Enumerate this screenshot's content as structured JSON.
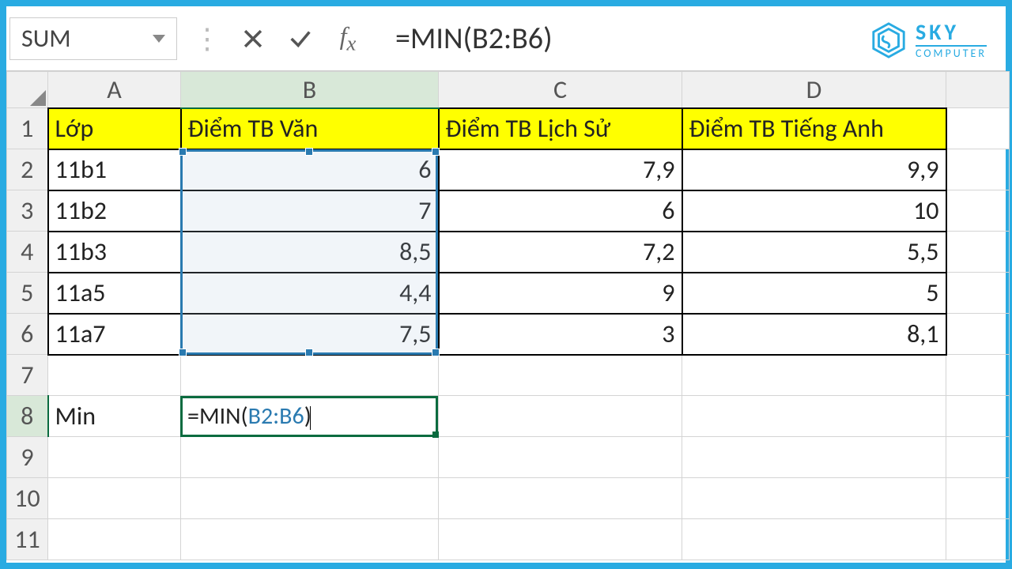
{
  "formula_bar": {
    "name_box": "SUM",
    "formula": "=MIN(B2:B6)"
  },
  "logo": {
    "top": "SKY",
    "bot": "COMPUTER"
  },
  "columns": [
    "A",
    "B",
    "C",
    "D"
  ],
  "headers": {
    "a": "Lớp",
    "b": "Điểm TB Văn",
    "c": "Điểm TB Lịch Sử",
    "d": "Điểm TB Tiếng Anh"
  },
  "rows": [
    {
      "n": "1"
    },
    {
      "n": "2",
      "a": "11b1",
      "b": "6",
      "c": "7,9",
      "d": "9,9"
    },
    {
      "n": "3",
      "a": "11b2",
      "b": "7",
      "c": "6",
      "d": "10"
    },
    {
      "n": "4",
      "a": "11b3",
      "b": "8,5",
      "c": "7,2",
      "d": "5,5"
    },
    {
      "n": "5",
      "a": "11a5",
      "b": "4,4",
      "c": "9",
      "d": "5"
    },
    {
      "n": "6",
      "a": "11a7",
      "b": "7,5",
      "c": "3",
      "d": "8,1"
    },
    {
      "n": "7"
    },
    {
      "n": "8",
      "a": "Min"
    },
    {
      "n": "9"
    },
    {
      "n": "10"
    },
    {
      "n": "11"
    }
  ],
  "active_formula": {
    "prefix": "=MIN(",
    "ref": "B2:B6",
    "suffix": ")"
  }
}
